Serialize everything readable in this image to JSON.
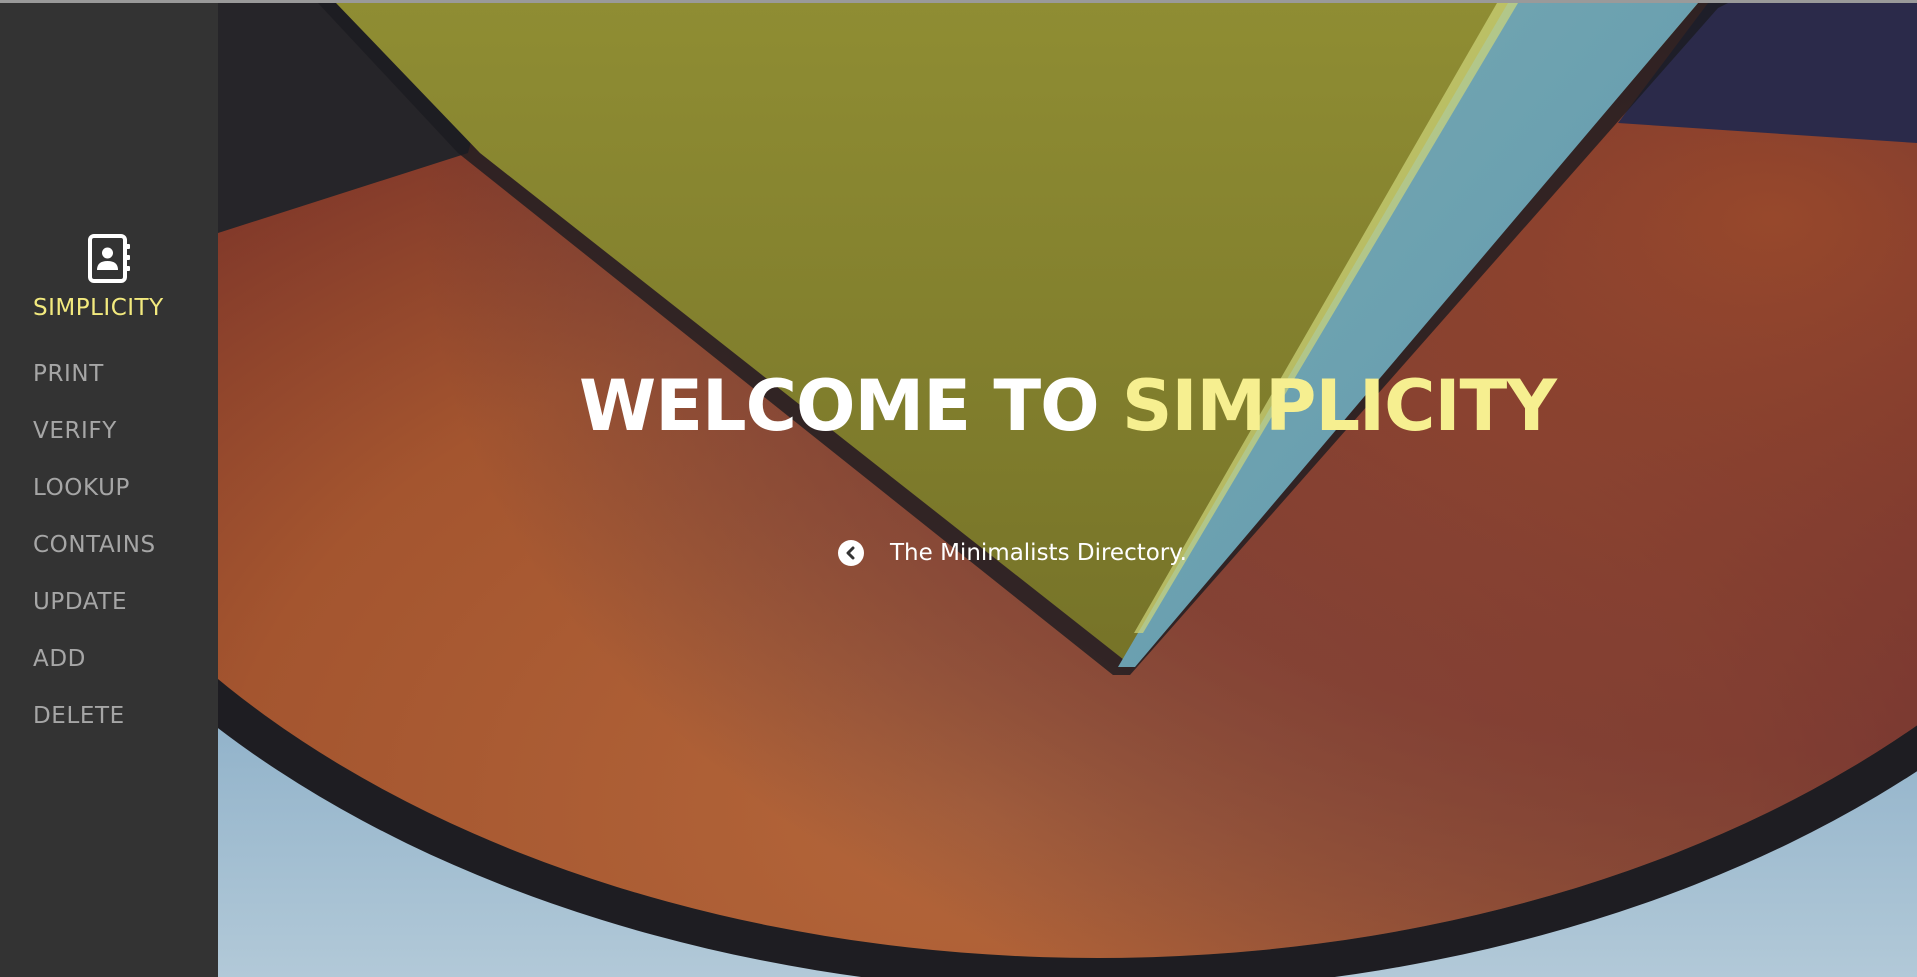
{
  "brand": {
    "name": "SIMPLICITY",
    "icon": "address-book-icon",
    "accent_color": "#f3ea7e"
  },
  "nav": {
    "items": [
      {
        "label": "PRINT"
      },
      {
        "label": "VERIFY"
      },
      {
        "label": "LOOKUP"
      },
      {
        "label": "CONTAINS"
      },
      {
        "label": "UPDATE"
      },
      {
        "label": "ADD"
      },
      {
        "label": "DELETE"
      }
    ]
  },
  "hero": {
    "title_prefix": "WELCOME TO",
    "title_accent": "SIMPLICITY",
    "tagline": "The Minimalists Directory.",
    "back_icon": "chevron-left-circle-icon"
  }
}
